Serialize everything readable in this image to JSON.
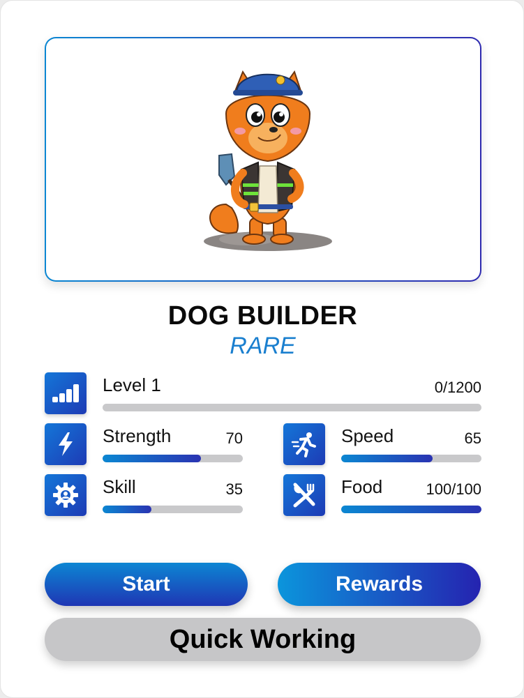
{
  "card": {
    "title": "DOG BUILDER",
    "rarity": "RARE"
  },
  "level": {
    "label": "Level 1",
    "progress_text": "0/1200",
    "progress_fraction": 0.0,
    "icon": "signal-bars-icon"
  },
  "stats": {
    "strength": {
      "label": "Strength",
      "value": "70",
      "fill_fraction": 0.7,
      "icon": "lightning-icon"
    },
    "speed": {
      "label": "Speed",
      "value": "65",
      "fill_fraction": 0.65,
      "icon": "running-icon"
    },
    "skill": {
      "label": "Skill",
      "value": "35",
      "fill_fraction": 0.35,
      "icon": "gear-icon"
    },
    "food": {
      "label": "Food",
      "value": "100/100",
      "fill_fraction": 1.0,
      "icon": "fork-knife-icon"
    }
  },
  "buttons": {
    "start": "Start",
    "rewards": "Rewards",
    "quick_working": "Quick Working"
  },
  "colors": {
    "accent_start": "#0b87d2",
    "accent_end": "#2a33b2",
    "rarity": "#1a7fcf",
    "track": "#c9c9cb"
  }
}
